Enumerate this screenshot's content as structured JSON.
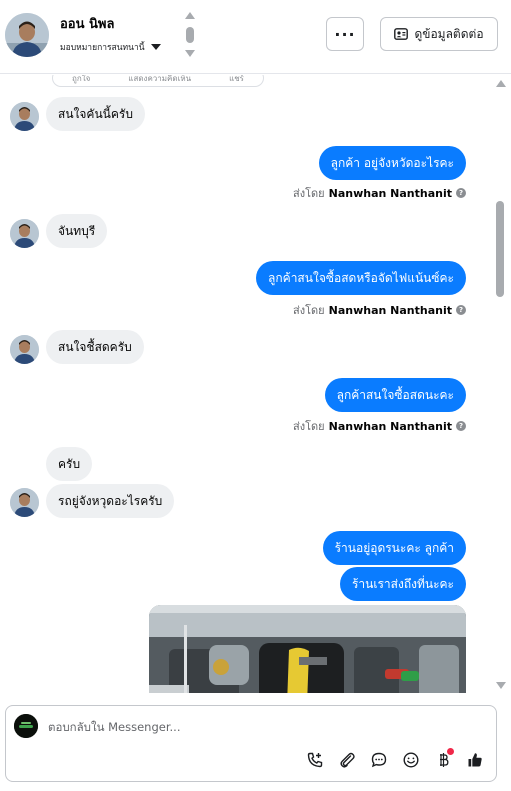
{
  "header": {
    "contact_name": "ออน นิพล",
    "assign_label": "มอบหมายการสนทนานี้",
    "more_label": "···",
    "contact_info_label": "ดูข้อมูลติดต่อ"
  },
  "reaction_strip": {
    "like": "ถูกใจ",
    "comment": "แสดงความคิดเห็น",
    "share": "แชร์"
  },
  "messages": [
    {
      "dir": "in",
      "text": "สนใจคันนี้ครับ"
    },
    {
      "dir": "out",
      "text": "ลูกค้า อยู่จังหวัดอะไรคะ",
      "sent_by_prefix": "ส่งโดย",
      "sent_by_name": "Nanwhan Nanthanit"
    },
    {
      "dir": "in",
      "text": "จันทบุรี"
    },
    {
      "dir": "out",
      "text": "ลูกค้าสนใจซื้อสดหรือจัดไฟแน้นซ์คะ",
      "sent_by_prefix": "ส่งโดย",
      "sent_by_name": "Nanwhan Nanthanit"
    },
    {
      "dir": "in",
      "text": "สนใจชื้สดครับ"
    },
    {
      "dir": "out",
      "text": "ลูกค้าสนใจซื้อสดนะคะ",
      "sent_by_prefix": "ส่งโดย",
      "sent_by_name": "Nanwhan Nanthanit"
    },
    {
      "dir": "in",
      "text": "ครับ"
    },
    {
      "dir": "in",
      "text": "รถยู่จังหวุดอะไรครับ"
    },
    {
      "dir": "out",
      "text": "ร้านอยู่อุดรนะคะ ลูกค้า"
    },
    {
      "dir": "out",
      "text": "ร้านเราส่งถึงที่นะคะ"
    }
  ],
  "composer": {
    "placeholder": "ตอบกลับใน Messenger...",
    "tools": [
      "add-call-icon",
      "paperclip-icon",
      "saved-reply-icon",
      "emoji-icon",
      "payment-icon",
      "like-icon"
    ]
  },
  "colors": {
    "outgoing_bubble": "#0a7cff",
    "incoming_bubble": "#eef0f2",
    "notification_dot": "#f02849"
  }
}
